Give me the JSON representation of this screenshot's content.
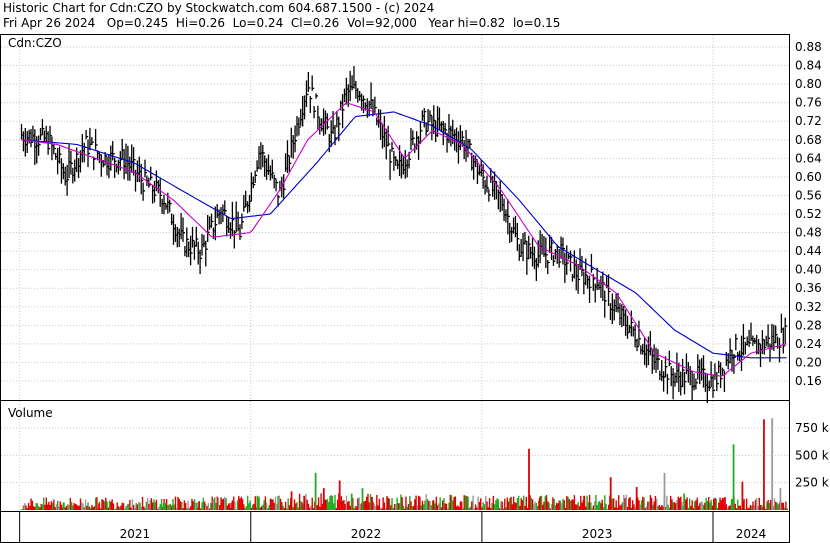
{
  "header": {
    "line1": "Historic Chart for Cdn:CZO by Stockwatch.com 604.687.1500 - (c) 2024",
    "line2": "Fri Apr 26 2024   Op=0.245  Hi=0.26  Lo=0.24  Cl=0.26  Vol=92,000   Year hi=0.82  lo=0.15"
  },
  "chart_data": [
    {
      "type": "ohlc",
      "title": "Cdn:CZO",
      "ylim": [
        0.13,
        0.9
      ],
      "y_ticks": [
        "0.88",
        "0.84",
        "0.80",
        "0.76",
        "0.72",
        "0.68",
        "0.64",
        "0.60",
        "0.56",
        "0.52",
        "0.48",
        "0.44",
        "0.40",
        "0.36",
        "0.32",
        "0.28",
        "0.24",
        "0.20",
        "0.16"
      ],
      "x_labels": [
        "2021",
        "2022",
        "2023",
        "2024"
      ],
      "close_path": [
        [
          "2021-01-04",
          0.69
        ],
        [
          "2021-02-15",
          0.68
        ],
        [
          "2021-03-15",
          0.6
        ],
        [
          "2021-04-15",
          0.67
        ],
        [
          "2021-05-15",
          0.64
        ],
        [
          "2021-06-15",
          0.64
        ],
        [
          "2021-07-15",
          0.59
        ],
        [
          "2021-08-15",
          0.56
        ],
        [
          "2021-09-15",
          0.46
        ],
        [
          "2021-10-15",
          0.44
        ],
        [
          "2021-11-15",
          0.53
        ],
        [
          "2021-12-15",
          0.48
        ],
        [
          "2022-01-15",
          0.66
        ],
        [
          "2022-02-15",
          0.56
        ],
        [
          "2022-03-01",
          0.63
        ],
        [
          "2022-03-15",
          0.71
        ],
        [
          "2022-04-01",
          0.8
        ],
        [
          "2022-04-20",
          0.73
        ],
        [
          "2022-05-10",
          0.68
        ],
        [
          "2022-06-01",
          0.78
        ],
        [
          "2022-06-20",
          0.79
        ],
        [
          "2022-07-10",
          0.75
        ],
        [
          "2022-08-01",
          0.68
        ],
        [
          "2022-08-20",
          0.61
        ],
        [
          "2022-09-10",
          0.66
        ],
        [
          "2022-10-01",
          0.72
        ],
        [
          "2022-11-01",
          0.7
        ],
        [
          "2022-12-01",
          0.68
        ],
        [
          "2023-01-01",
          0.6
        ],
        [
          "2023-02-01",
          0.55
        ],
        [
          "2023-03-01",
          0.45
        ],
        [
          "2023-04-01",
          0.43
        ],
        [
          "2023-05-01",
          0.44
        ],
        [
          "2023-06-01",
          0.39
        ],
        [
          "2023-07-01",
          0.38
        ],
        [
          "2023-08-01",
          0.31
        ],
        [
          "2023-09-01",
          0.26
        ],
        [
          "2023-10-01",
          0.2
        ],
        [
          "2023-11-01",
          0.17
        ],
        [
          "2023-12-01",
          0.17
        ],
        [
          "2024-01-05",
          0.16
        ],
        [
          "2024-02-01",
          0.23
        ],
        [
          "2024-03-01",
          0.23
        ],
        [
          "2024-04-26",
          0.26
        ]
      ],
      "ma_short_path": [
        [
          "2021-01-04",
          0.68
        ],
        [
          "2021-03-01",
          0.67
        ],
        [
          "2021-05-01",
          0.64
        ],
        [
          "2021-07-01",
          0.61
        ],
        [
          "2021-09-01",
          0.55
        ],
        [
          "2021-11-01",
          0.47
        ],
        [
          "2022-01-01",
          0.48
        ],
        [
          "2022-02-15",
          0.57
        ],
        [
          "2022-04-01",
          0.68
        ],
        [
          "2022-06-01",
          0.76
        ],
        [
          "2022-07-15",
          0.74
        ],
        [
          "2022-09-01",
          0.64
        ],
        [
          "2022-10-15",
          0.7
        ],
        [
          "2022-12-01",
          0.67
        ],
        [
          "2023-02-01",
          0.57
        ],
        [
          "2023-04-01",
          0.45
        ],
        [
          "2023-06-01",
          0.41
        ],
        [
          "2023-08-01",
          0.35
        ],
        [
          "2023-10-01",
          0.22
        ],
        [
          "2023-12-01",
          0.18
        ],
        [
          "2024-01-15",
          0.17
        ],
        [
          "2024-03-01",
          0.22
        ],
        [
          "2024-04-26",
          0.24
        ]
      ],
      "ma_long_path": [
        [
          "2021-01-04",
          0.68
        ],
        [
          "2021-04-01",
          0.67
        ],
        [
          "2021-07-01",
          0.63
        ],
        [
          "2021-09-15",
          0.57
        ],
        [
          "2021-12-01",
          0.51
        ],
        [
          "2022-02-01",
          0.52
        ],
        [
          "2022-04-15",
          0.63
        ],
        [
          "2022-06-15",
          0.73
        ],
        [
          "2022-08-15",
          0.74
        ],
        [
          "2022-10-15",
          0.71
        ],
        [
          "2022-12-15",
          0.66
        ],
        [
          "2023-03-01",
          0.55
        ],
        [
          "2023-05-01",
          0.45
        ],
        [
          "2023-07-01",
          0.4
        ],
        [
          "2023-09-01",
          0.35
        ],
        [
          "2023-11-01",
          0.27
        ],
        [
          "2024-01-01",
          0.22
        ],
        [
          "2024-03-01",
          0.21
        ],
        [
          "2024-04-26",
          0.21
        ]
      ],
      "colors": {
        "price": "#000000",
        "ma_short": "#cc00cc",
        "ma_long": "#0000cc",
        "grid": "#c8c8c8"
      }
    },
    {
      "type": "bar",
      "title": "Volume",
      "y_ticks": [
        "750 k",
        "500 k",
        "250 k"
      ],
      "ylim": [
        0,
        950
      ],
      "spikes": [
        [
          "2021-01-20",
          40,
          "red"
        ],
        [
          "2021-03-10",
          70,
          "green"
        ],
        [
          "2021-05-05",
          60,
          "red"
        ],
        [
          "2021-06-20",
          55,
          "green"
        ],
        [
          "2021-08-15",
          60,
          "green"
        ],
        [
          "2021-10-10",
          80,
          "red"
        ],
        [
          "2021-12-01",
          70,
          "red"
        ],
        [
          "2022-01-10",
          130,
          "green"
        ],
        [
          "2022-03-05",
          170,
          "red"
        ],
        [
          "2022-03-25",
          130,
          "red"
        ],
        [
          "2022-04-12",
          340,
          "green"
        ],
        [
          "2022-04-25",
          200,
          "red"
        ],
        [
          "2022-05-20",
          270,
          "red"
        ],
        [
          "2022-06-08",
          150,
          "green"
        ],
        [
          "2022-06-25",
          200,
          "green"
        ],
        [
          "2022-07-10",
          120,
          "red"
        ],
        [
          "2022-08-05",
          110,
          "red"
        ],
        [
          "2022-10-15",
          90,
          "red"
        ],
        [
          "2022-12-05",
          130,
          "green"
        ],
        [
          "2023-01-25",
          90,
          "green"
        ],
        [
          "2023-03-15",
          560,
          "red"
        ],
        [
          "2023-04-01",
          110,
          "red"
        ],
        [
          "2023-06-10",
          130,
          "red"
        ],
        [
          "2023-07-22",
          300,
          "red"
        ],
        [
          "2023-09-01",
          210,
          "red"
        ],
        [
          "2023-10-15",
          340,
          "gray"
        ],
        [
          "2023-11-15",
          150,
          "green"
        ],
        [
          "2024-02-01",
          600,
          "green"
        ],
        [
          "2024-02-15",
          260,
          "red"
        ],
        [
          "2024-03-20",
          830,
          "red"
        ],
        [
          "2024-04-02",
          840,
          "gray"
        ],
        [
          "2024-04-15",
          200,
          "gray"
        ]
      ],
      "base_levels": [
        [
          "2021-01-04",
          95
        ],
        [
          "2022-01-01",
          110
        ],
        [
          "2022-06-01",
          140
        ],
        [
          "2023-01-01",
          110
        ],
        [
          "2023-09-01",
          120
        ],
        [
          "2024-04-26",
          90
        ]
      ],
      "colors": {
        "up": "#22aa22",
        "down": "#dd0000",
        "flat": "#9a9a9a"
      }
    }
  ],
  "price_label": "Cdn:CZO",
  "volume_label": "Volume",
  "x_labels": [
    "2021",
    "2022",
    "2023",
    "2024"
  ]
}
